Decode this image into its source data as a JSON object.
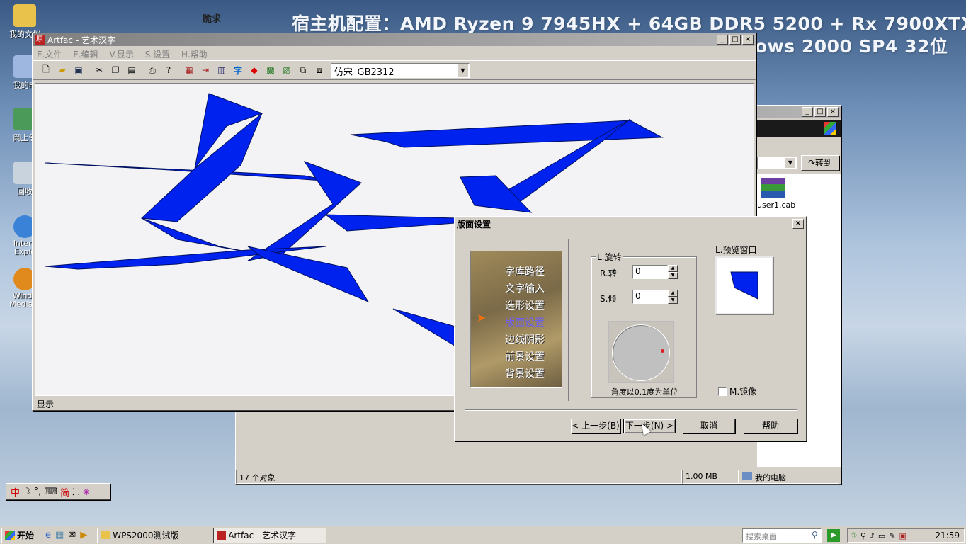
{
  "desktop": {
    "banner_line1": "宿主机配置：AMD Ryzen 9 7945HX + 64GB DDR5 5200 + Rx 7900XTX",
    "banner_line2_visible": "ows 2000 SP4 32位",
    "sticker": "跪求",
    "icons": [
      "我的文档",
      "我的电",
      "网上邻",
      "回收",
      "Intern\nExplo",
      "Windo\nMedia P"
    ]
  },
  "bg_window": {
    "go_label": "转到",
    "file_name": "user1.cab",
    "status_objects": "17 个对象",
    "status_size": "1.00 MB",
    "status_location": "我的电脑"
  },
  "artfac": {
    "title": "Artfac - 艺术汉字",
    "menu": [
      "E.文件",
      "E.编辑",
      "V.显示",
      "S.设置",
      "H.帮助"
    ],
    "font_select": "仿宋_GB2312",
    "status": "显示",
    "canvas_chars": "文字",
    "glyph_color": "#0022ee",
    "toolbar_icons": [
      "new-icon",
      "open-icon",
      "save-icon",
      "cut-icon",
      "copy-icon",
      "paste-icon",
      "print-icon",
      "help-icon",
      "tool-icon-1",
      "tool-icon-2",
      "tool-icon-3",
      "char-icon",
      "color-icon",
      "tool-icon-4",
      "tool-icon-5",
      "tool-icon-6",
      "tool-icon-7"
    ],
    "char_tool_label": "字"
  },
  "dialog": {
    "title": "版面设置",
    "nav": [
      "字库路径",
      "文字输入",
      "选形设置",
      "版面设置",
      "边线阴影",
      "前景设置",
      "背景设置"
    ],
    "active_nav": "版面设置",
    "rotate_group": "L.旋转",
    "rotate_label": "R.转",
    "rotate_value": "0",
    "skew_label": "S.倾",
    "skew_value": "0",
    "angle_note": "角度以0.1度为单位",
    "preview_label": "L.预览窗口",
    "mirror_label": "M.镜像",
    "btn_prev": "< 上一步(B)",
    "btn_next": "下一步(N) >",
    "btn_cancel": "取消",
    "btn_help": "帮助"
  },
  "ime": {
    "label": "中",
    "simp": "简"
  },
  "taskbar": {
    "start": "开始",
    "tasks": [
      "WPS2000测试版",
      "Artfac - 艺术汉字"
    ],
    "search_placeholder": "搜索桌面",
    "clock": "21:59"
  }
}
